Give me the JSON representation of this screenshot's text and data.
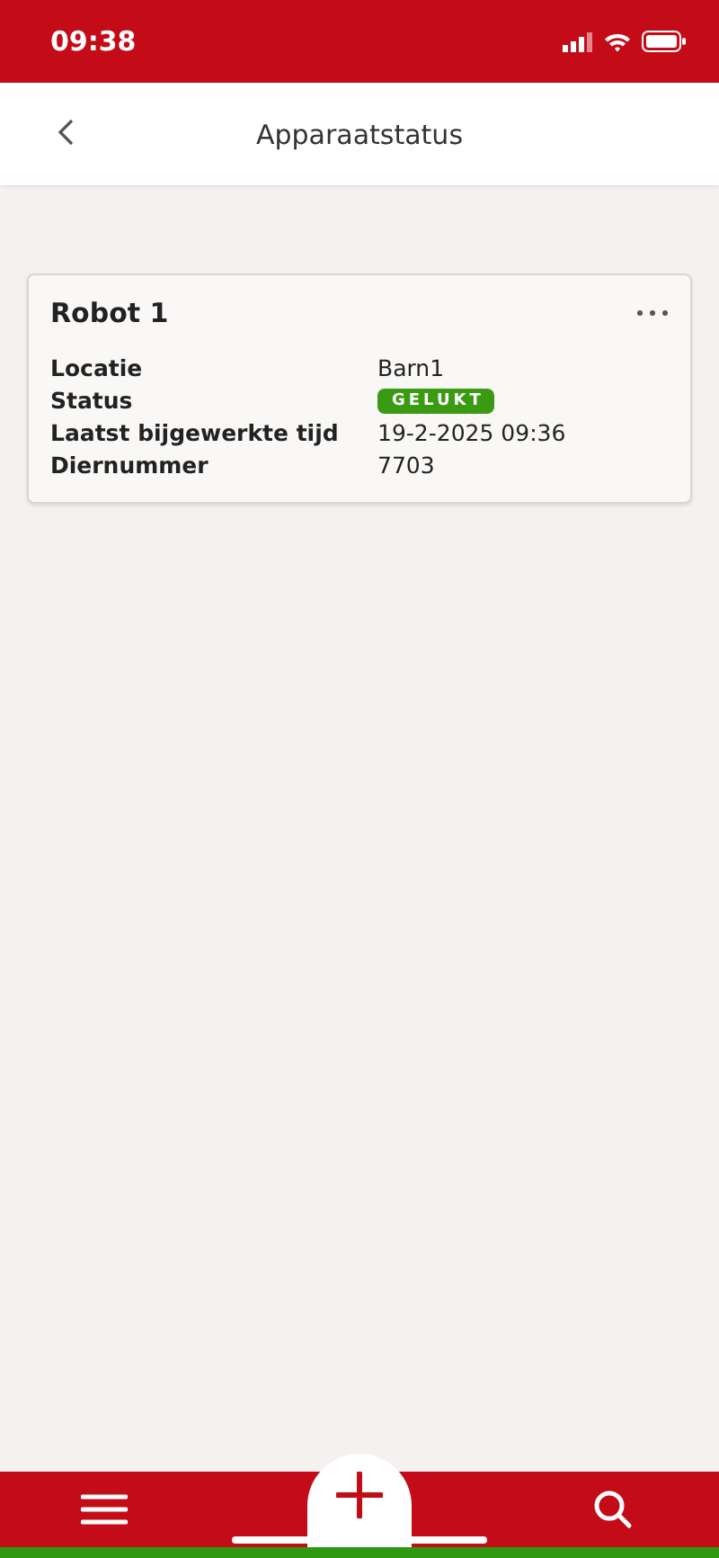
{
  "status_bar": {
    "time": "09:38"
  },
  "header": {
    "title": "Apparaatstatus"
  },
  "card": {
    "title": "Robot 1",
    "rows": [
      {
        "label": "Locatie",
        "value": "Barn1",
        "kind": "text"
      },
      {
        "label": "Status",
        "value": "GELUKT",
        "kind": "badge",
        "color": "#3a9a12"
      },
      {
        "label": "Laatst bijgewerkte tijd",
        "value": "19-2-2025 09:36",
        "kind": "text"
      },
      {
        "label": "Diernummer",
        "value": "7703",
        "kind": "text"
      }
    ]
  }
}
